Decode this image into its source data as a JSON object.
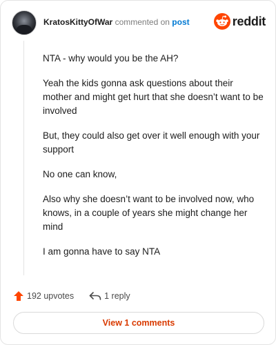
{
  "header": {
    "username": "KratosKittyOfWar",
    "meta": " commented on ",
    "post_link": "post",
    "brand": "reddit"
  },
  "comment": {
    "paragraphs": [
      "NTA - why would you be the AH?",
      "Yeah the kids gonna ask questions about their mother and might get hurt that she doesn’t want to be involved",
      "But, they could also get over it well enough with your support",
      "No one can know,",
      "Also why she doesn’t want to be involved now, who knows, in a couple of years she might change her mind",
      "I am gonna have to say NTA"
    ]
  },
  "actions": {
    "upvotes": "192 upvotes",
    "replies": "1 reply"
  },
  "footer": {
    "view_comments": "View 1 comments"
  },
  "colors": {
    "brand": "#ff4500",
    "link": "#0079d3",
    "view_button_text": "#d93a00"
  },
  "icons": {
    "brand": "reddit-logo-icon",
    "upvote": "upvote-arrow-icon",
    "reply": "reply-arrow-icon"
  }
}
